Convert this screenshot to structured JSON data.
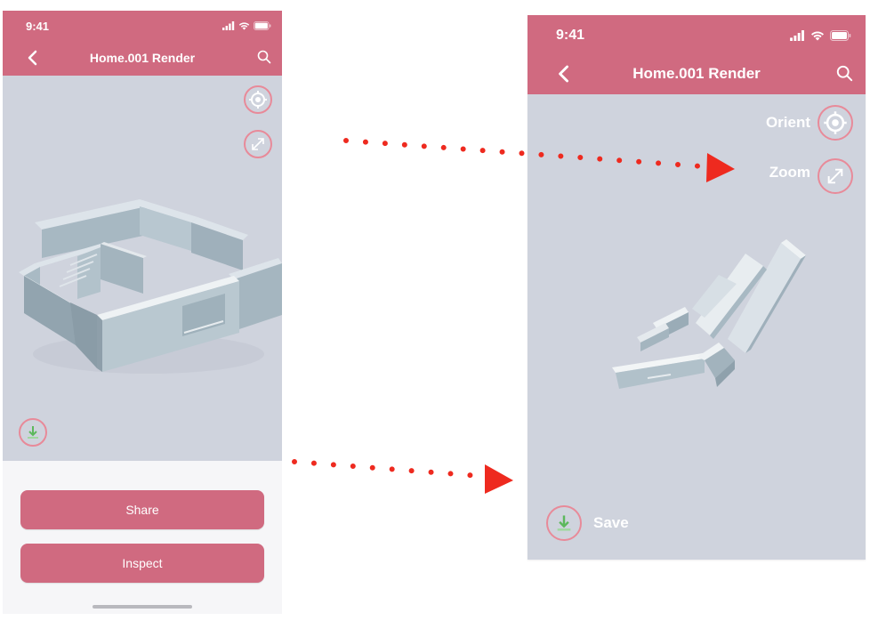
{
  "screens": {
    "before": {
      "status_time": "9:41",
      "title": "Home.001 Render",
      "actions": {
        "share": "Share",
        "inspect": "Inspect"
      }
    },
    "after": {
      "status_time": "9:41",
      "title": "Home.001 Render",
      "labels": {
        "orient": "Orient",
        "zoom": "Zoom",
        "save": "Save"
      }
    }
  },
  "icons": {
    "back": "chevron-left-icon",
    "search": "search-icon",
    "orient": "target-icon",
    "zoom": "expand-icon",
    "save": "download-icon",
    "signal": "signal-icon",
    "wifi": "wifi-icon",
    "battery": "battery-icon"
  },
  "colors": {
    "header": "#d06a80",
    "viewport": "#cfd3dd",
    "button_ring": "#e88a99",
    "save_arrow": "#5cb85c",
    "annotation_arrow": "#ee2a1f"
  }
}
